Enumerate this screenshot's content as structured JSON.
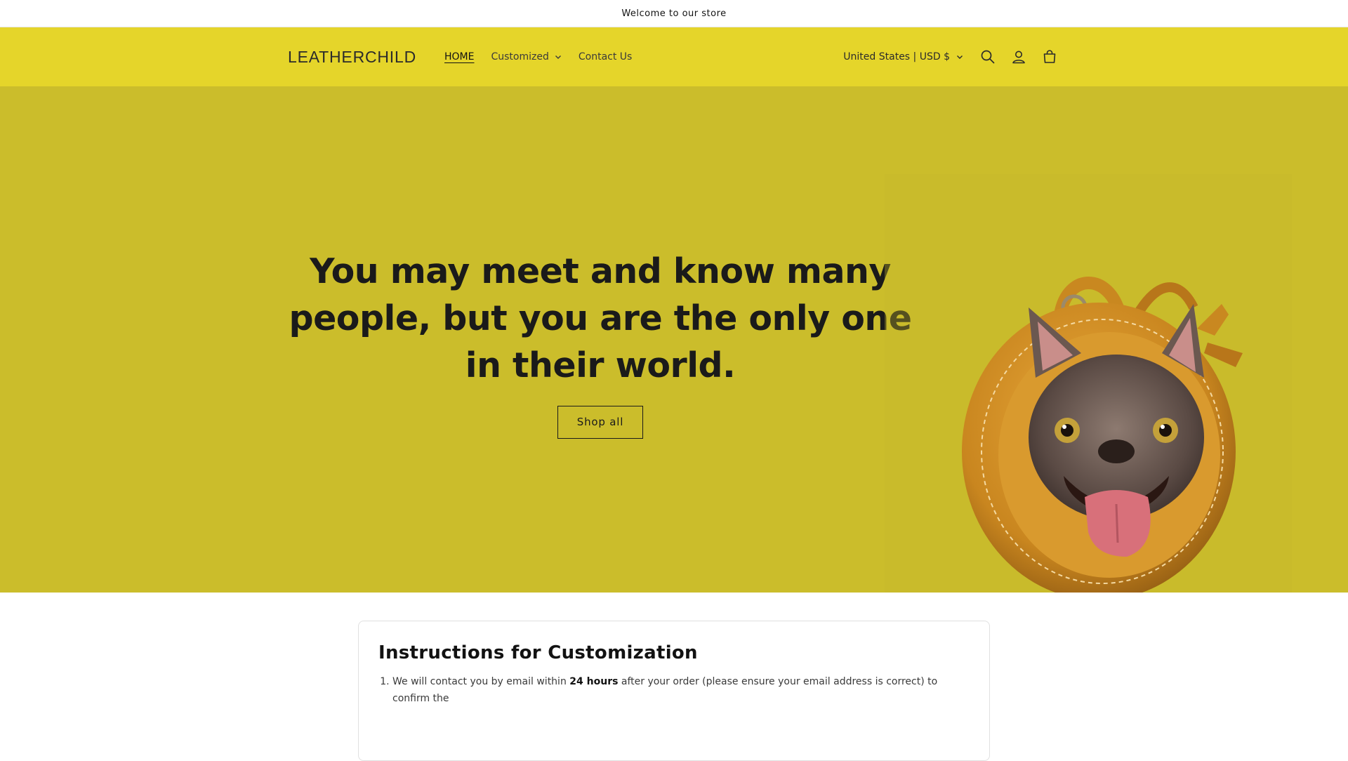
{
  "announcement": {
    "text": "Welcome to our store"
  },
  "header": {
    "logo": "LEATHERCHILD",
    "nav": [
      {
        "label": "HOME",
        "active": true
      },
      {
        "label": "Customized",
        "dropdown": true
      },
      {
        "label": "Contact Us"
      }
    ],
    "locale": "United States | USD $",
    "icons": [
      "search-icon",
      "account-icon",
      "cart-icon"
    ]
  },
  "hero": {
    "heading": "You may meet and know many people, but you are the only one in their world.",
    "button_label": "Shop all",
    "image": "french-bulldog-leather-tag-image"
  },
  "instructions": {
    "title": "Instructions for Customization",
    "item1_prefix": "We will contact you by email within ",
    "item1_bold": "24 hours",
    "item1_suffix": " after your order (please ensure your email address is correct) to confirm the"
  },
  "colors": {
    "header_bg": "#e5d52a",
    "hero_bg": "#cbbd2b",
    "text": "#121212"
  }
}
